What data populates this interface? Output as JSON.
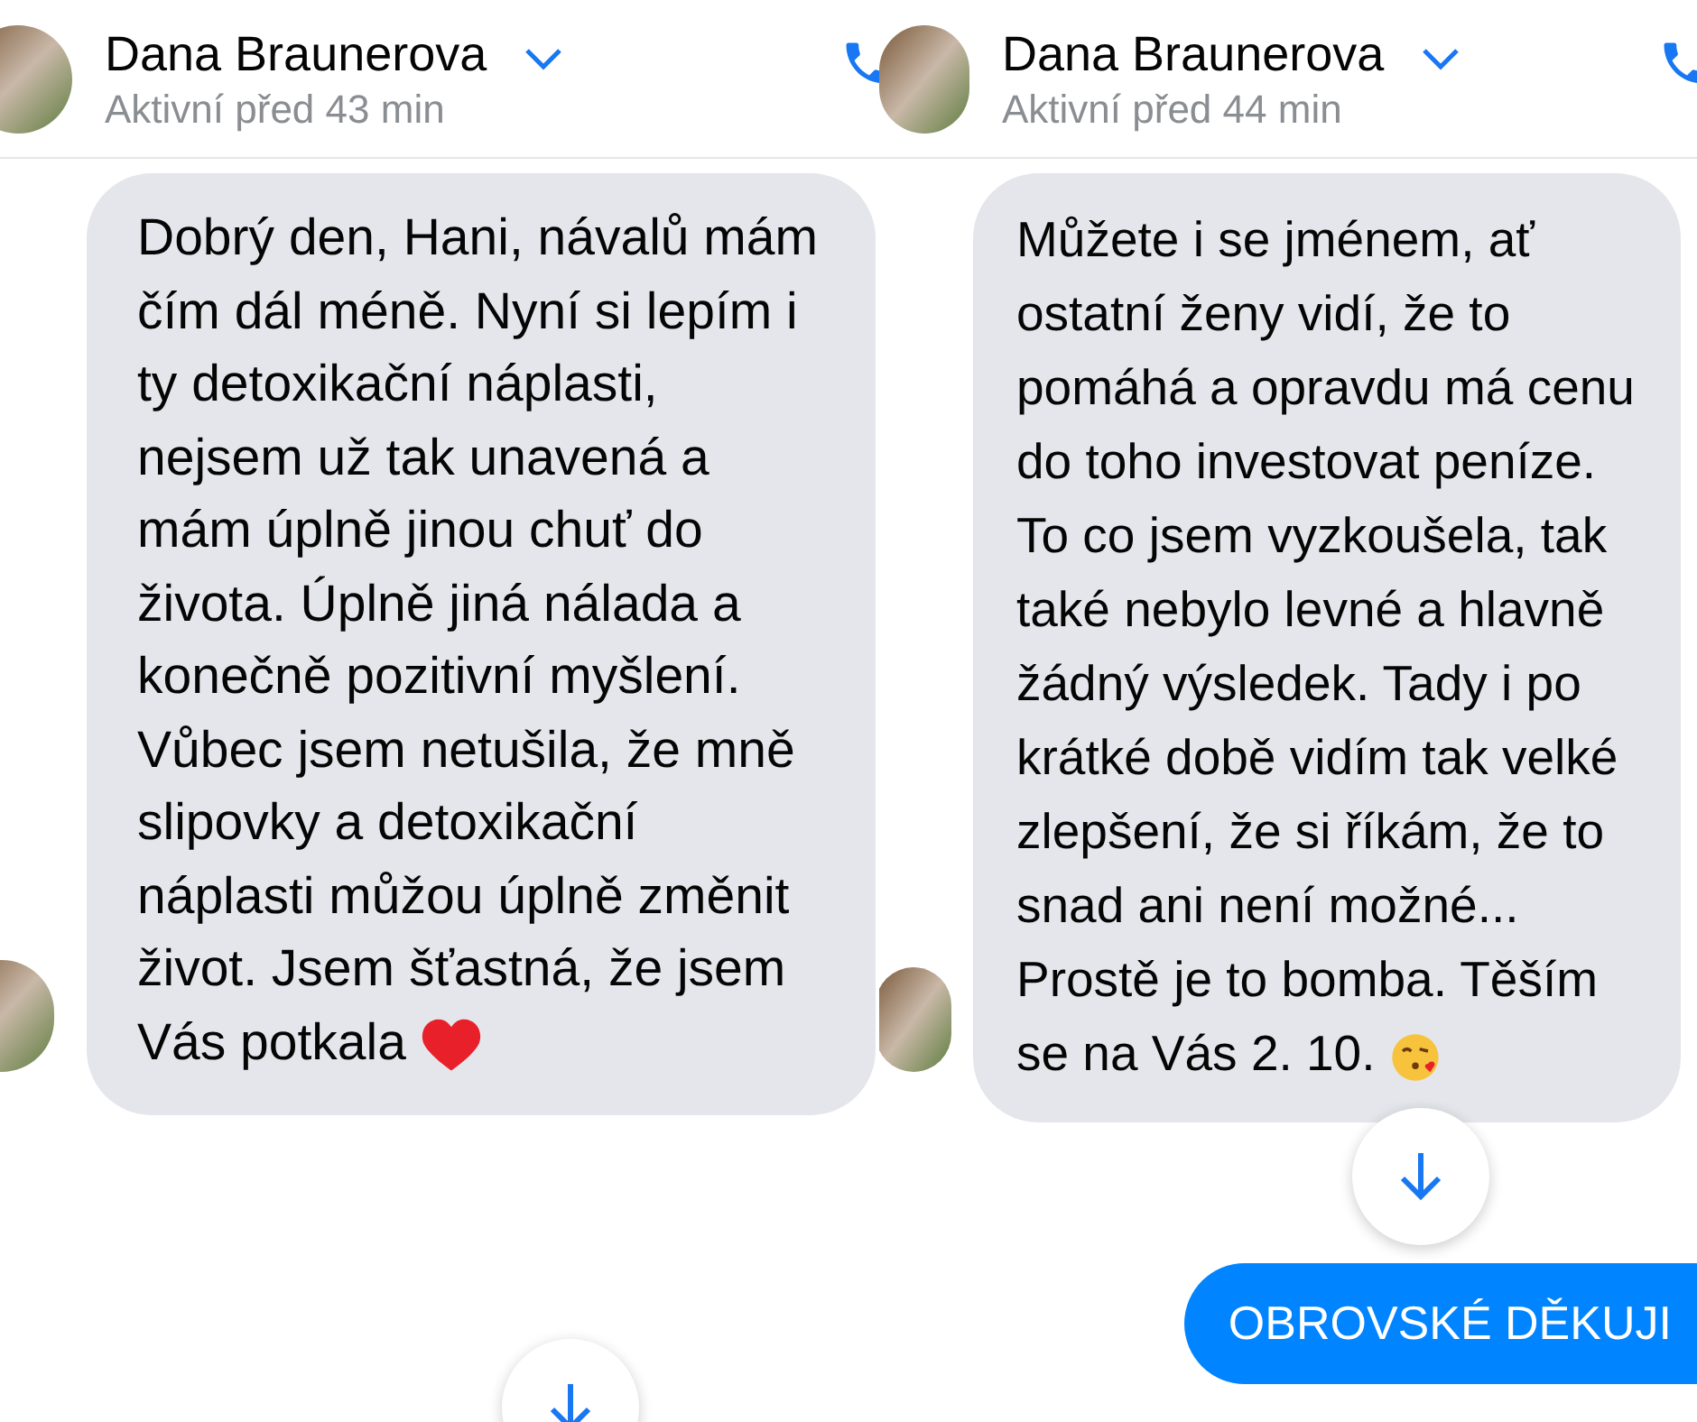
{
  "chats": [
    {
      "contact": {
        "name": "Dana Braunerova",
        "status": "Aktivní před 43 min"
      },
      "messages": [
        {
          "kind": "received",
          "text": "Dobrý den, Hani, návalů mám čím dál méně. Nyní si lepím i ty detoxikační náplasti, nejsem už tak unavená a mám úplně jinou chuť do života. Úplně jiná nálada a konečně pozitivní myšlení. Vůbec jsem netušila, že mně slipovky a detoxikační náplasti můžou úplně změnit život. Jsem šťastná, že jsem Vás potkala",
          "heart": true,
          "kiss": false
        }
      ]
    },
    {
      "contact": {
        "name": "Dana Braunerova",
        "status": "Aktivní před 44 min"
      },
      "messages": [
        {
          "kind": "received",
          "text": "Můžete i se jménem, ať ostatní ženy vidí, že to pomáhá a opravdu má cenu do toho investovat peníze. To co jsem vyzkoušela, tak také nebylo levné a hlavně žádný výsledek. Tady i po krátké době vidím tak velké zlepšení, že si říkám, že to snad ani není možné...  Prostě je to bomba. Těším se na Vás 2. 10.",
          "heart": false,
          "kiss": true
        },
        {
          "kind": "sent",
          "text": "OBROVSKÉ DĚKUJI"
        }
      ]
    }
  ]
}
